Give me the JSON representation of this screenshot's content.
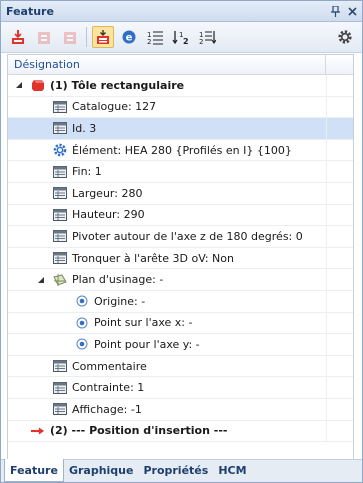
{
  "window": {
    "title": "Feature"
  },
  "column_header": "Désignation",
  "rows": [
    {
      "label": "(1) Tôle rectangulaire",
      "level": 0,
      "toggle": "expanded",
      "icon": "red-cube-icon",
      "bold": true
    },
    {
      "label": "Catalogue: 127",
      "level": 1,
      "icon": "property-icon"
    },
    {
      "label": "Id. 3",
      "level": 1,
      "icon": "property-icon",
      "selected": true
    },
    {
      "label": "Élément: HEA 280 {Profilés en I} {100}",
      "level": 1,
      "icon": "gear-icon"
    },
    {
      "label": "Fin: 1",
      "level": 1,
      "icon": "property-icon"
    },
    {
      "label": "Largeur: 280",
      "level": 1,
      "icon": "property-icon"
    },
    {
      "label": "Hauteur: 290",
      "level": 1,
      "icon": "property-icon"
    },
    {
      "label": "Pivoter autour de l'axe z de 180 degrés: 0",
      "level": 1,
      "icon": "property-icon"
    },
    {
      "label": "Tronquer à l'arête 3D oV: Non",
      "level": 1,
      "icon": "property-icon"
    },
    {
      "label": "Plan d'usinage: -",
      "level": 1,
      "toggle": "expanded",
      "icon": "plane-icon"
    },
    {
      "label": "Origine: -",
      "level": 2,
      "icon": "radio-point-icon"
    },
    {
      "label": "Point sur l'axe x: -",
      "level": 2,
      "icon": "radio-point-icon"
    },
    {
      "label": "Point pour l'axe y: -",
      "level": 2,
      "icon": "radio-point-icon"
    },
    {
      "label": "Commentaire",
      "level": 1,
      "icon": "property-icon"
    },
    {
      "label": "Contrainte: 1",
      "level": 1,
      "icon": "property-icon"
    },
    {
      "label": "Affichage: -1",
      "level": 1,
      "icon": "property-icon"
    },
    {
      "label": "(2) --- Position  d'insertion ---",
      "level": 0,
      "icon": "red-arrow-icon",
      "bold": true
    }
  ],
  "tabs": [
    "Feature",
    "Graphique",
    "Propriétés",
    "HCM"
  ],
  "colors": {
    "selection": "#cfe0f7",
    "header_text": "#1f4e9c",
    "accent_red": "#e0332b"
  }
}
